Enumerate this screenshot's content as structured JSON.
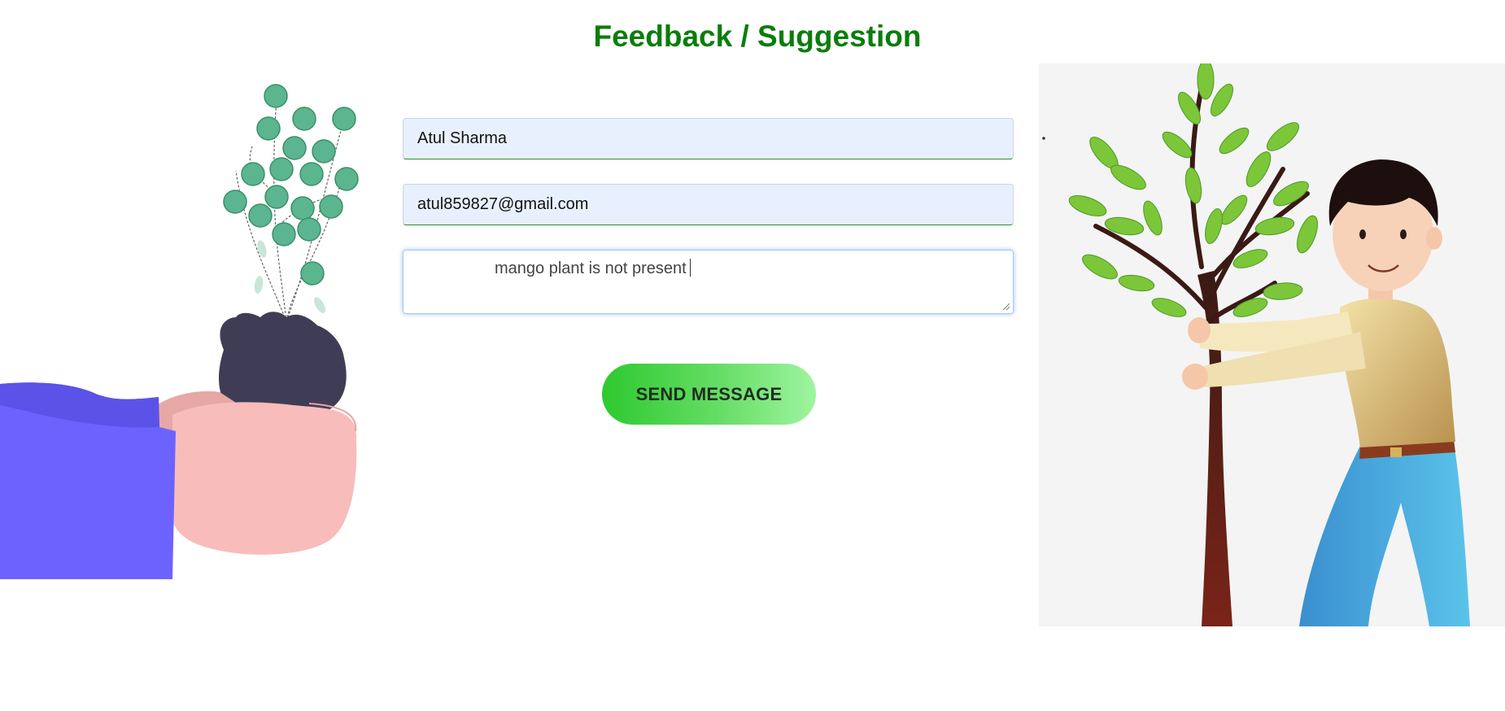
{
  "page": {
    "title": "Feedback / Suggestion"
  },
  "form": {
    "name_value": "Atul Sharma",
    "email_value": "atul859827@gmail.com",
    "message_value": "mango plant is not present",
    "send_label": "SEND MESSAGE"
  },
  "colors": {
    "title": "#0a7d0a",
    "field_bg": "#e8f0fe",
    "button_start": "#2ec92e",
    "button_end": "#9ff59f"
  },
  "illustrations": {
    "left": "hands-holding-plant-illustration",
    "right": "boy-planting-tree-illustration"
  }
}
